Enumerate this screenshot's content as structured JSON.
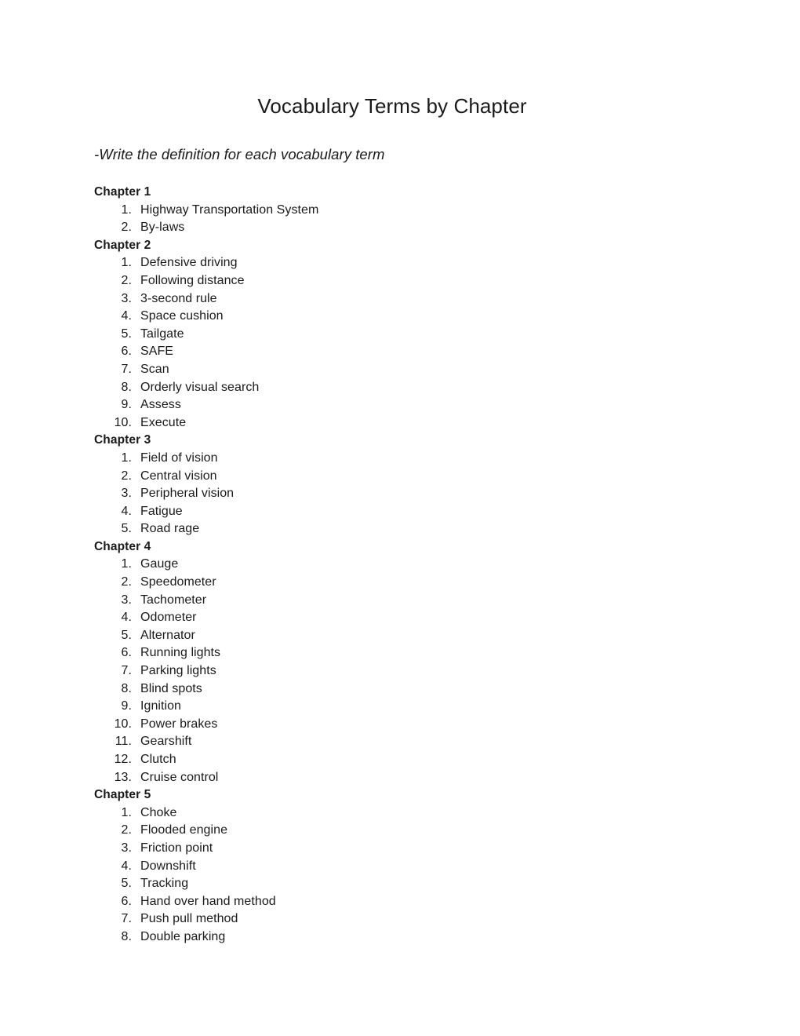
{
  "document": {
    "title": "Vocabulary Terms by Chapter",
    "subtitle": "-Write the definition for each vocabulary term",
    "chapters": [
      {
        "heading": "Chapter 1",
        "terms": [
          "Highway Transportation System",
          "By-laws"
        ]
      },
      {
        "heading": "Chapter 2",
        "terms": [
          "Defensive driving",
          "Following distance",
          "3-second rule",
          "Space cushion",
          "Tailgate",
          "SAFE",
          "Scan",
          "Orderly visual search",
          "Assess",
          "Execute"
        ]
      },
      {
        "heading": "Chapter 3",
        "terms": [
          "Field of vision",
          "Central vision",
          "Peripheral vision",
          "Fatigue",
          "Road rage"
        ]
      },
      {
        "heading": "Chapter 4",
        "terms": [
          "Gauge",
          "Speedometer",
          "Tachometer",
          "Odometer",
          "Alternator",
          "Running lights",
          "Parking lights",
          "Blind spots",
          "Ignition",
          "Power brakes",
          "Gearshift",
          "Clutch",
          "Cruise control"
        ]
      },
      {
        "heading": "Chapter 5",
        "terms": [
          "Choke",
          "Flooded engine",
          "Friction point",
          "Downshift",
          "Tracking",
          "Hand over hand method",
          "Push pull method",
          "Double parking"
        ]
      }
    ]
  }
}
